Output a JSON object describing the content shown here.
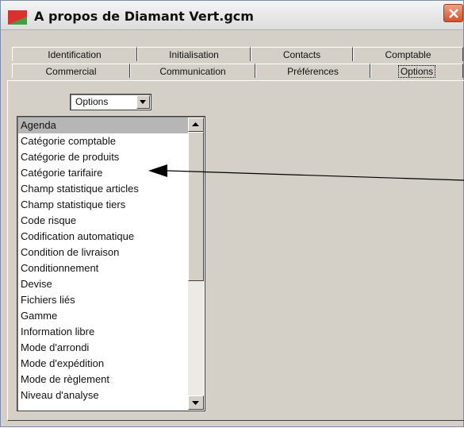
{
  "window": {
    "title": "A propos de Diamant Vert.gcm"
  },
  "colors": {
    "app_icon_red": "#d8312e",
    "app_icon_green": "#3ea13a",
    "close_button": "#d8502a"
  },
  "tabs_row1": [
    {
      "label": "Identification"
    },
    {
      "label": "Initialisation"
    },
    {
      "label": "Contacts"
    },
    {
      "label": "Comptable"
    }
  ],
  "tabs_row2": [
    {
      "label": "Commercial"
    },
    {
      "label": "Communication"
    },
    {
      "label": "Préférences"
    },
    {
      "label": "Options",
      "active": true
    }
  ],
  "options_select": {
    "value": "Options"
  },
  "options_list": {
    "selected": "Agenda",
    "items": [
      "Agenda",
      "Catégorie comptable",
      "Catégorie de produits",
      "Catégorie tarifaire",
      "Champ statistique articles",
      "Champ statistique tiers",
      "Code risque",
      "Codification automatique",
      "Condition de livraison",
      "Conditionnement",
      "Devise",
      "Fichiers liés",
      "Gamme",
      "Information libre",
      "Mode d'arrondi",
      "Mode d'expédition",
      "Mode de règlement",
      "Niveau d'analyse"
    ]
  },
  "icons": {
    "app": "app-logo-icon",
    "close": "close-icon",
    "dropdown": "chevron-down-icon",
    "scroll_up": "scroll-up-icon",
    "scroll_down": "scroll-down-icon",
    "callout": "arrow-pointer-icon"
  }
}
